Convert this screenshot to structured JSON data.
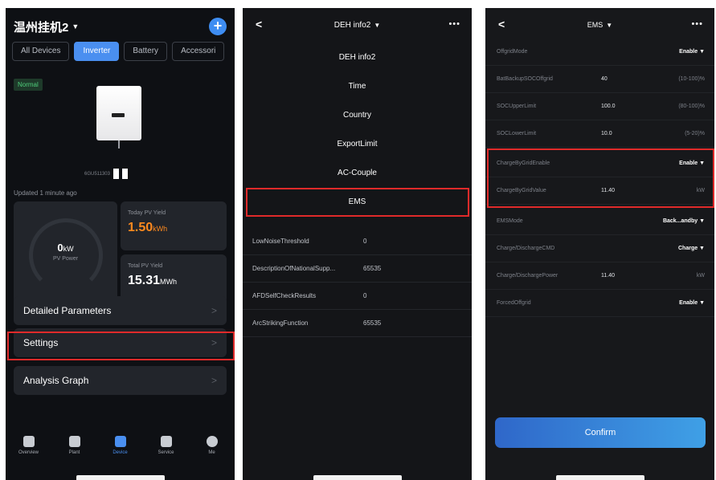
{
  "phone1": {
    "title": "温州挂机2",
    "caret": "▼",
    "plus": "+",
    "tabs": [
      "All Devices",
      "Inverter",
      "Battery",
      "Accessori"
    ],
    "status": "Normal",
    "serial": "6GU511303",
    "updated": "Updated 1 minute ago",
    "pv_power_value": "0",
    "pv_power_unit": "kW",
    "pv_power_label": "PV Power",
    "today_label": "Today PV Yield",
    "today_value": "1.50",
    "today_unit": "kWh",
    "total_label": "Total PV Yield",
    "total_value": "15.31",
    "total_unit": "MWh",
    "menu": [
      {
        "label": "Detailed Parameters",
        "chevron": ">"
      },
      {
        "label": "Settings",
        "chevron": ">"
      },
      {
        "label": "Analysis Graph",
        "chevron": ">"
      }
    ],
    "nav": [
      {
        "label": "Overview",
        "icon": "overview-icon"
      },
      {
        "label": "Plant",
        "icon": "plant-icon"
      },
      {
        "label": "Device",
        "icon": "device-icon"
      },
      {
        "label": "Service",
        "icon": "service-icon"
      },
      {
        "label": "Me",
        "icon": "me-icon"
      }
    ]
  },
  "phone2": {
    "back": "<",
    "title": "DEH info2",
    "caret": "▼",
    "more": "•••",
    "dropdown": [
      "DEH info2",
      "Time",
      "Country",
      "ExportLimit",
      "AC-Couple",
      "EMS"
    ],
    "rows": [
      {
        "key": "LowNoiseThreshold",
        "value": "0"
      },
      {
        "key": "DescriptionOfNationalSupp...",
        "value": "65535"
      },
      {
        "key": "AFDSelfCheckResults",
        "value": "0"
      },
      {
        "key": "ArcStrikingFunction",
        "value": "65535"
      }
    ]
  },
  "phone3": {
    "back": "<",
    "title": "EMS",
    "caret": "▼",
    "more": "•••",
    "rows": [
      {
        "key": "OffgridMode",
        "value": "",
        "right": "Enable ▼"
      },
      {
        "key": "BatBackupSOCOffgrid",
        "value": "40",
        "right": "(10-100)%"
      },
      {
        "key": "SOCUpperLimit",
        "value": "100.0",
        "right": "(80-100)%"
      },
      {
        "key": "SOCLowerLimit",
        "value": "10.0",
        "right": "(5-20)%"
      },
      {
        "key": "ChargeByGridEnable",
        "value": "",
        "right": "Enable ▼"
      },
      {
        "key": "ChargeByGridValue",
        "value": "11.40",
        "right": "kW"
      },
      {
        "key": "EMSMode",
        "value": "",
        "right": "Back...andby ▼"
      },
      {
        "key": "Charge/DischargeCMD",
        "value": "",
        "right": "Charge ▼"
      },
      {
        "key": "Charge/DischargePower",
        "value": "11.40",
        "right": "kW"
      },
      {
        "key": "ForcedOffgrid",
        "value": "",
        "right": "Enable ▼"
      }
    ],
    "confirm": "Confirm"
  },
  "colors": {
    "accent_blue": "#4a8ff0",
    "highlight_red": "#e02a2a",
    "yield_orange": "#ff8a1e",
    "status_green": "#4fce7b"
  }
}
